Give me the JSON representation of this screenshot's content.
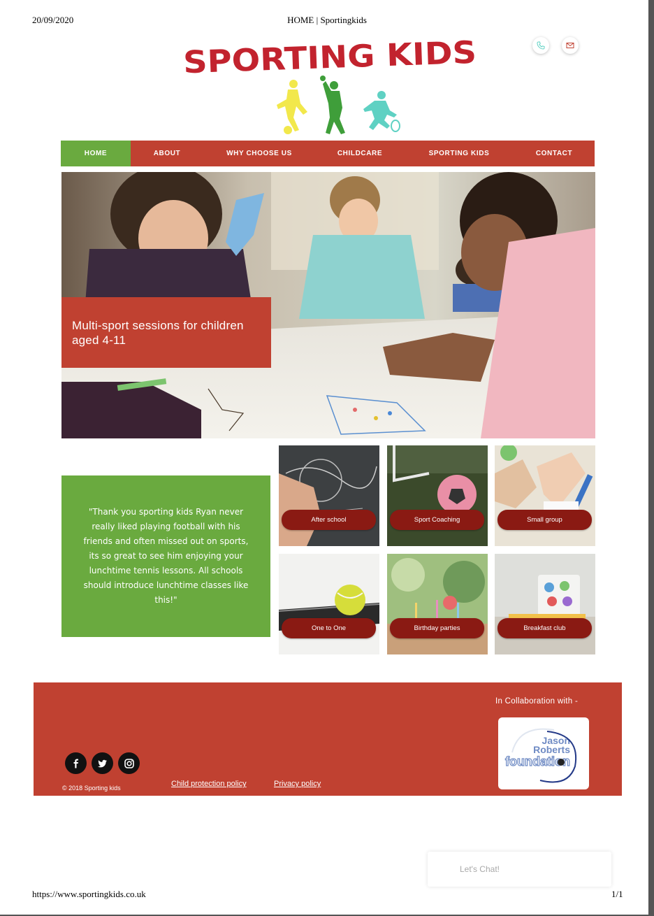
{
  "print_header": {
    "date": "20/09/2020",
    "title": "HOME | Sportingkids"
  },
  "print_footer": {
    "url": "https://www.sportingkids.co.uk",
    "page": "1/1"
  },
  "logo": {
    "text": "SPORTING KIDS",
    "figure_colors": [
      "#f2e84b",
      "#3f9e3a",
      "#5fd1c3"
    ]
  },
  "contact_icons": [
    "phone-icon",
    "mail-icon"
  ],
  "nav": {
    "items": [
      {
        "label": "HOME",
        "active": true
      },
      {
        "label": "ABOUT"
      },
      {
        "label": "WHY CHOOSE US"
      },
      {
        "label": "CHILDCARE"
      },
      {
        "label": "SPORTING KIDS"
      },
      {
        "label": "CONTACT"
      }
    ]
  },
  "hero": {
    "caption": "Multi-sport sessions for children aged 4-11"
  },
  "testimonial": {
    "quote": "\"Thank you sporting kids Ryan never really liked playing football with his friends and often missed out on sports, its so great to see him enjoying your lunchtime tennis lessons. All schools should introduce lunchtime classes like this!\""
  },
  "services": [
    {
      "label": "After school"
    },
    {
      "label": "Sport Coaching"
    },
    {
      "label": "Small group"
    },
    {
      "label": "One to One"
    },
    {
      "label": "Birthday parties"
    },
    {
      "label": "Breakfast club"
    }
  ],
  "footer": {
    "collab_label": "In Collaboration with -",
    "partner_logo_text": [
      "Jason",
      "Roberts",
      "foundation"
    ],
    "social_icons": [
      "facebook-icon",
      "twitter-icon",
      "instagram-icon"
    ],
    "copyright": "© 2018 Sporting kids",
    "links": [
      "Child protection policy",
      "Privacy policy"
    ]
  },
  "chat": {
    "placeholder": "Let's Chat!"
  },
  "colors": {
    "brand_red": "#c04131",
    "brand_green": "#6aaa3f",
    "button_dark_red": "#8a1a13"
  }
}
